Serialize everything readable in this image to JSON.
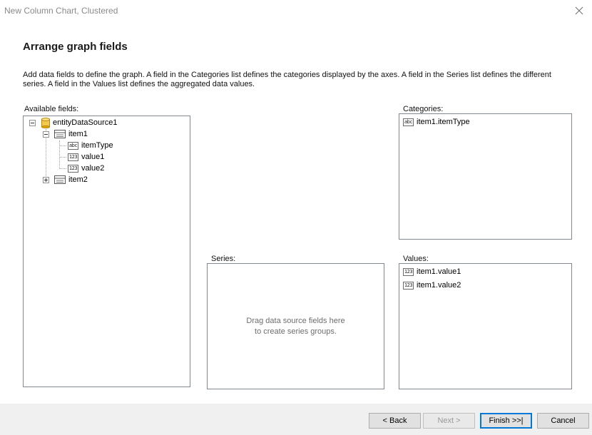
{
  "window": {
    "title": "New Column Chart, Clustered"
  },
  "heading": "Arrange graph fields",
  "description": "Add data fields to define the graph. A field in the Categories list defines the categories displayed by the axes. A field in the Series list defines the different series. A field in the Values list defines the aggregated data values.",
  "available_fields": {
    "label": "Available fields:",
    "tree": {
      "root": "entityDataSource1",
      "item1": "item1",
      "item1_children": [
        "itemType",
        "value1",
        "value2"
      ],
      "item2": "item2"
    }
  },
  "categories": {
    "label": "Categories:",
    "items": [
      "item1.itemType"
    ]
  },
  "series": {
    "label": "Series:",
    "placeholder_line1": "Drag data source fields here",
    "placeholder_line2": "to create series groups."
  },
  "values": {
    "label": "Values:",
    "items": [
      "item1.value1",
      "item1.value2"
    ]
  },
  "icons": {
    "abc": "abc",
    "num": "123"
  },
  "buttons": {
    "back": "< Back",
    "next": "Next >",
    "finish": "Finish >>|",
    "cancel": "Cancel"
  }
}
